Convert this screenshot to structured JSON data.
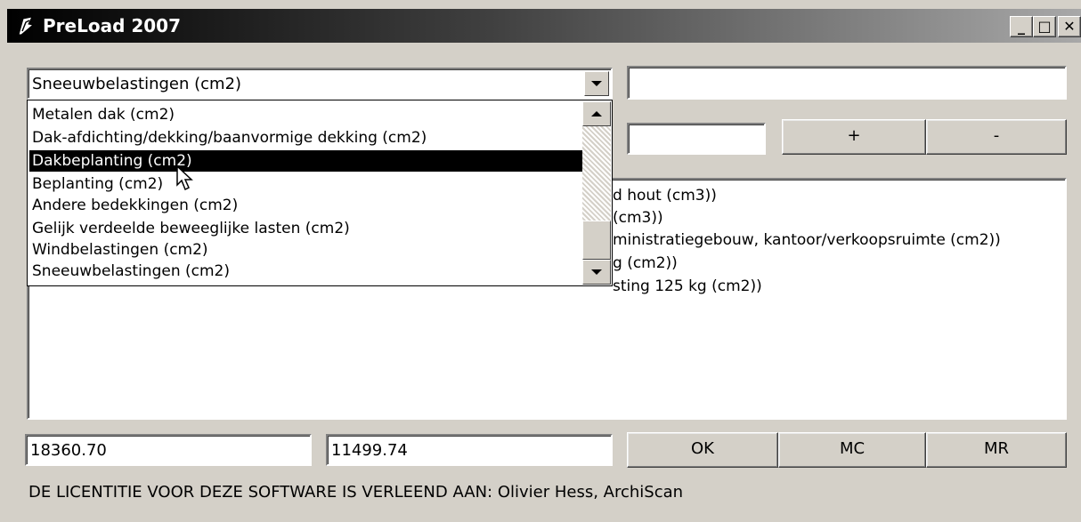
{
  "window": {
    "title": "PreLoad 2007",
    "controls": {
      "minimize": "_",
      "maximize": "□",
      "close": "✕"
    }
  },
  "combo": {
    "selected": "Sneeuwbelastingen (cm2)"
  },
  "top_right_field": {
    "value": ""
  },
  "mid_field": {
    "value": ""
  },
  "buttons": {
    "plus": "+",
    "minus": "-",
    "ok": "OK",
    "mc": "MC",
    "mr": "MR"
  },
  "dropdown": {
    "items": [
      "Metalen dak (cm2)",
      "Dak-afdichting/dekking/baanvormige dekking (cm2)",
      "Dakbeplanting (cm2)",
      "Beplanting (cm2)",
      "Andere bedekkingen (cm2)",
      "Gelijk verdeelde beweeglijke lasten (cm2)",
      "Windbelastingen (cm2)",
      "Sneeuwbelastingen (cm2)"
    ],
    "selected_index": 2
  },
  "memo": {
    "visible_lines": [
      "d hout (cm3))",
      "(cm3))",
      "ministratiegebouw, kantoor/verkoopsruimte (cm2))",
      "g (cm2))",
      "sting 125 kg (cm2))"
    ]
  },
  "totals": {
    "left": "18360.70",
    "right": "11499.74"
  },
  "license": "DE LICENTITIE VOOR DEZE SOFTWARE IS VERLEEND AAN: Olivier Hess, ArchiScan",
  "icons": [
    "app-icon",
    "minimize-icon",
    "maximize-icon",
    "close-icon",
    "chevron-down-icon",
    "scroll-up-icon",
    "scroll-down-icon",
    "mouse-cursor-icon"
  ]
}
